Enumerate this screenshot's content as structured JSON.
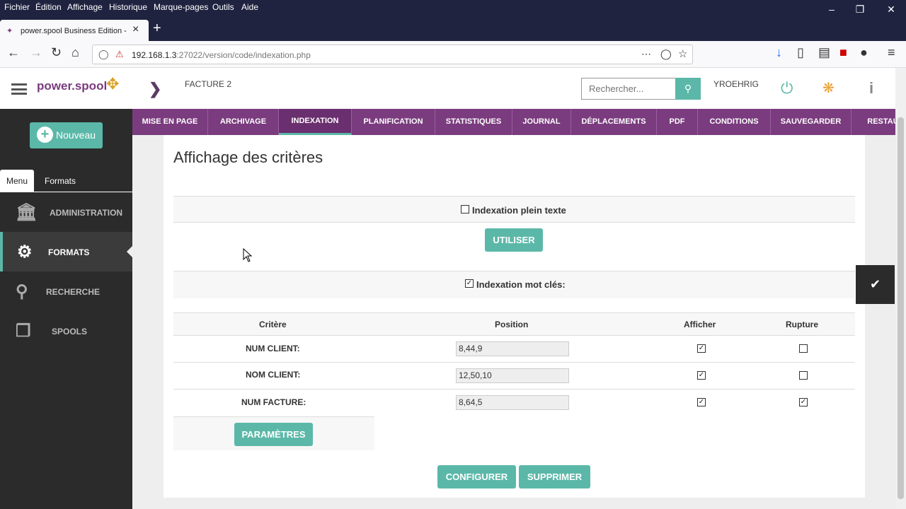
{
  "browser": {
    "menu": [
      "Fichier",
      "Édition",
      "Affichage",
      "Historique",
      "Marque-pages",
      "Outils",
      "Aide"
    ],
    "tab_title": "power.spool Business Edition -",
    "url_host": "192.168.1.3",
    "url_rest": ":27022/version/code/indexation.php"
  },
  "header": {
    "logo": "power.spool",
    "doc_title": "FACTURE 2",
    "search_placeholder": "Rechercher...",
    "user": "YROEHRIG"
  },
  "sidebar": {
    "new_button": "Nouveau",
    "tabs": [
      "Menu",
      "Formats"
    ],
    "items": [
      {
        "label": "ADMINISTRATION",
        "icon": "bank-icon"
      },
      {
        "label": "FORMATS",
        "icon": "gears-icon",
        "active": true
      },
      {
        "label": "RECHERCHE",
        "icon": "search-icon"
      },
      {
        "label": "SPOOLS",
        "icon": "cubes-icon"
      }
    ]
  },
  "navtabs": [
    "MISE EN PAGE",
    "ARCHIVAGE",
    "INDEXATION",
    "PLANIFICATION",
    "STATISTIQUES",
    "JOURNAL",
    "DÉPLACEMENTS",
    "PDF",
    "CONDITIONS",
    "SAUVEGARDER",
    "RESTAU"
  ],
  "active_navtab": "INDEXATION",
  "main": {
    "title": "Affichage des critères",
    "fulltext_label": "Indexation plein texte",
    "fulltext_checked": false,
    "use_button": "UTILISER",
    "keyword_label": "Indexation mot clés:",
    "keyword_checked": true,
    "table": {
      "headers": [
        "Critère",
        "Position",
        "Afficher",
        "Rupture"
      ],
      "rows": [
        {
          "critere": "NUM CLIENT:",
          "position": "8,44,9",
          "afficher": true,
          "rupture": false
        },
        {
          "critere": "NOM CLIENT:",
          "position": "12,50,10",
          "afficher": true,
          "rupture": false
        },
        {
          "critere": "NUM FACTURE:",
          "position": "8,64,5",
          "afficher": true,
          "rupture": true
        }
      ]
    },
    "params_button": "PARAMÈTRES",
    "configure_button": "CONFIGURER",
    "delete_button": "SUPPRIMER"
  },
  "colors": {
    "accent": "#5bb8a8",
    "brand": "#7a3c7e",
    "sidebar": "#2b2b2b"
  }
}
